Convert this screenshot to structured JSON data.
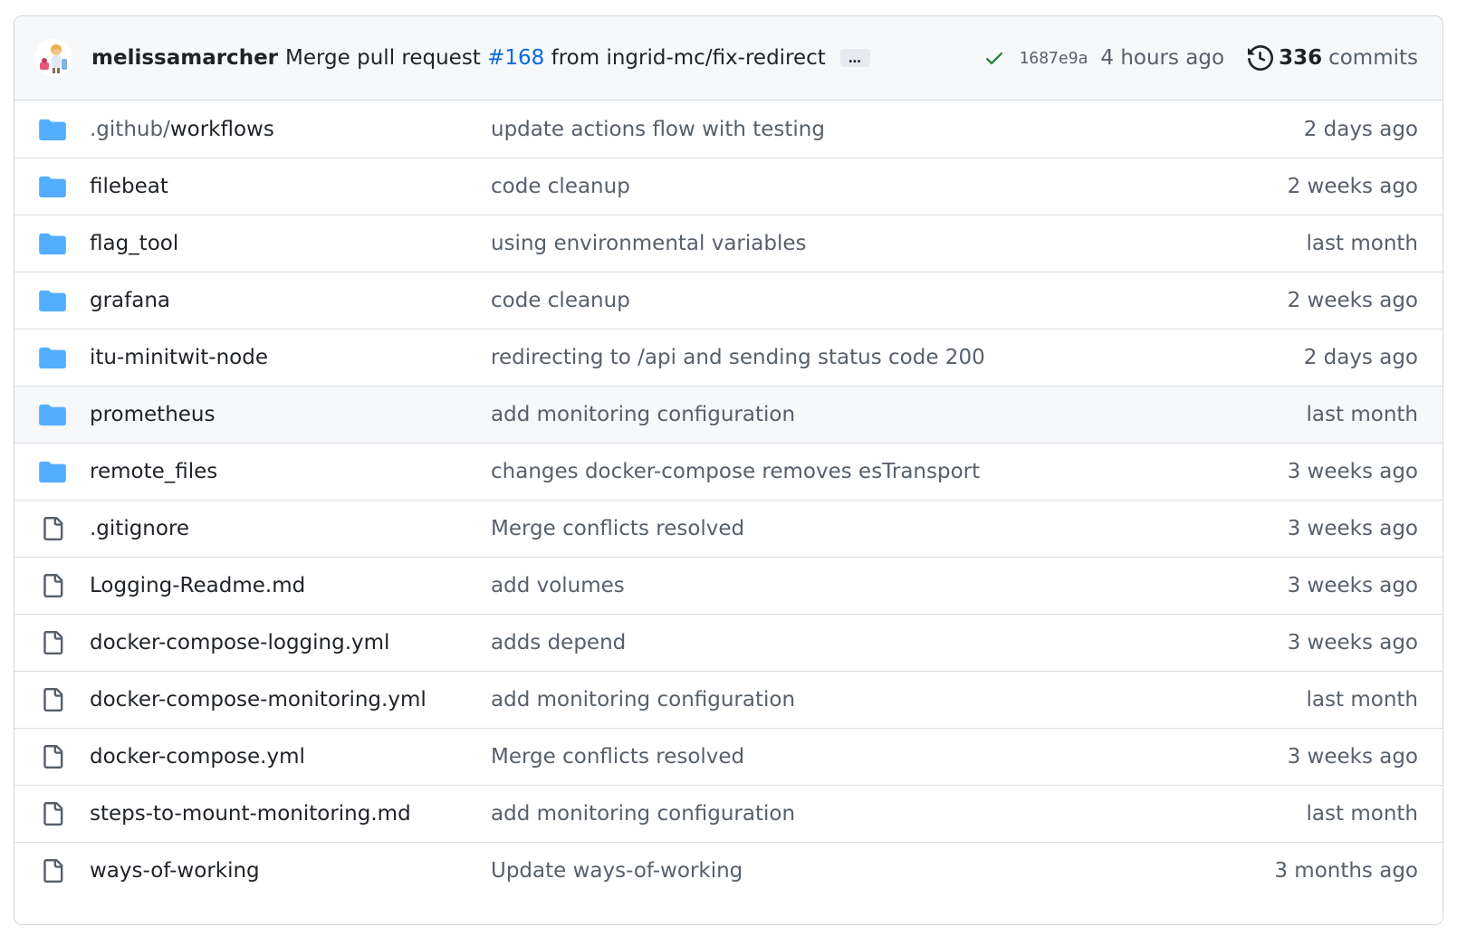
{
  "commit": {
    "author": "melissamarcher",
    "message_before": "Merge pull request ",
    "pr": "#168",
    "message_after": " from ingrid-mc/fix-redirect",
    "ellipsis": "…",
    "sha": "1687e9a",
    "time": "4 hours ago",
    "commit_count": "336",
    "commit_label": "commits",
    "status": "success"
  },
  "colors": {
    "folder": "#54aeff",
    "file": "#57606a",
    "link": "#0969da",
    "success": "#1a7f37"
  },
  "files": [
    {
      "type": "folder",
      "prefix": ".github/",
      "name": "workflows",
      "message": "update actions flow with testing",
      "age": "2 days ago"
    },
    {
      "type": "folder",
      "prefix": "",
      "name": "filebeat",
      "message": "code cleanup",
      "age": "2 weeks ago"
    },
    {
      "type": "folder",
      "prefix": "",
      "name": "flag_tool",
      "message": "using environmental variables",
      "age": "last month"
    },
    {
      "type": "folder",
      "prefix": "",
      "name": "grafana",
      "message": "code cleanup",
      "age": "2 weeks ago"
    },
    {
      "type": "folder",
      "prefix": "",
      "name": "itu-minitwit-node",
      "message": "redirecting to /api and sending status code 200",
      "age": "2 days ago"
    },
    {
      "type": "folder",
      "prefix": "",
      "name": "prometheus",
      "message": "add monitoring configuration",
      "age": "last month",
      "hover": true
    },
    {
      "type": "folder",
      "prefix": "",
      "name": "remote_files",
      "message": "changes docker-compose removes esTransport",
      "age": "3 weeks ago"
    },
    {
      "type": "file",
      "prefix": "",
      "name": ".gitignore",
      "message": "Merge conflicts resolved",
      "age": "3 weeks ago"
    },
    {
      "type": "file",
      "prefix": "",
      "name": "Logging-Readme.md",
      "message": "add volumes",
      "age": "3 weeks ago"
    },
    {
      "type": "file",
      "prefix": "",
      "name": "docker-compose-logging.yml",
      "message": "adds depend",
      "age": "3 weeks ago"
    },
    {
      "type": "file",
      "prefix": "",
      "name": "docker-compose-monitoring.yml",
      "message": "add monitoring configuration",
      "age": "last month"
    },
    {
      "type": "file",
      "prefix": "",
      "name": "docker-compose.yml",
      "message": "Merge conflicts resolved",
      "age": "3 weeks ago"
    },
    {
      "type": "file",
      "prefix": "",
      "name": "steps-to-mount-monitoring.md",
      "message": "add monitoring configuration",
      "age": "last month"
    },
    {
      "type": "file",
      "prefix": "",
      "name": "ways-of-working",
      "message": "Update ways-of-working",
      "age": "3 months ago"
    }
  ]
}
